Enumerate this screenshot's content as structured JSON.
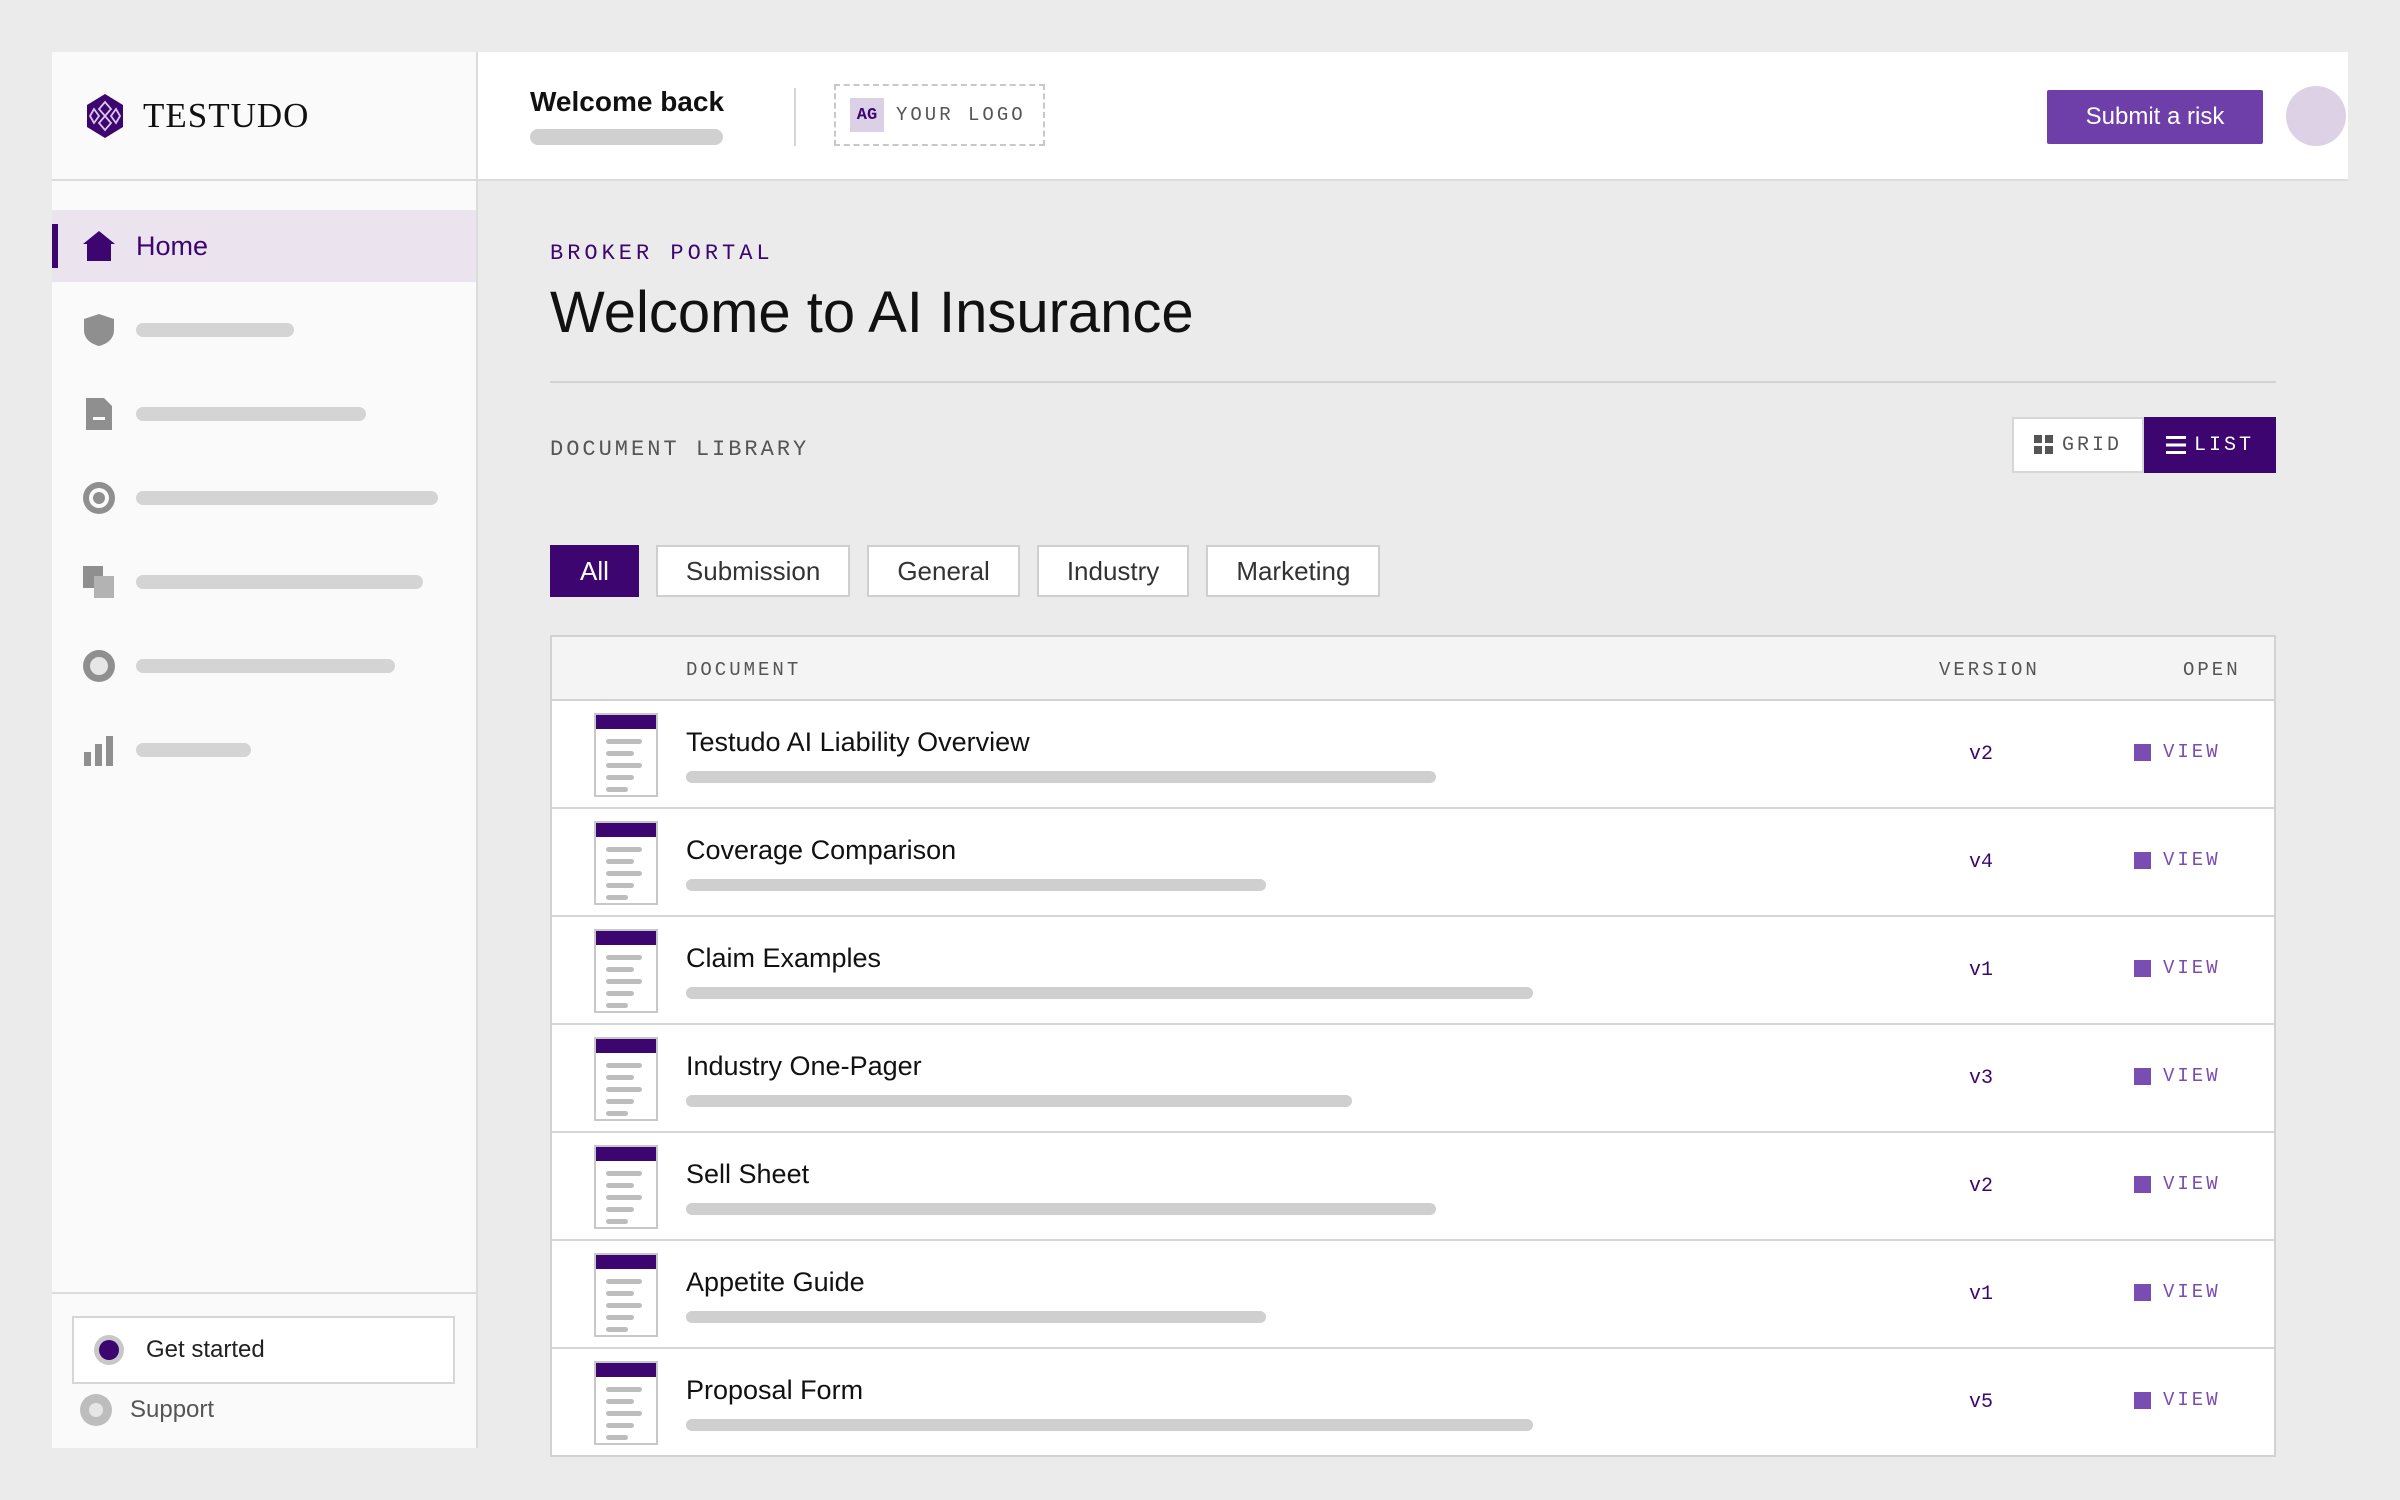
{
  "brand": {
    "name": "TESTUDO"
  },
  "nav": {
    "items": [
      {
        "label": "Home",
        "icon": "home-icon",
        "active": true
      },
      {
        "label": "",
        "icon": "shield-icon"
      },
      {
        "label": "",
        "icon": "document-icon"
      },
      {
        "label": "",
        "icon": "target-icon"
      },
      {
        "label": "",
        "icon": "copy-icon"
      },
      {
        "label": "",
        "icon": "circle-icon"
      },
      {
        "label": "",
        "icon": "bar-chart-icon"
      }
    ]
  },
  "sidebar_footer": {
    "get_started": "Get started",
    "support": "Support"
  },
  "header": {
    "welcome": "Welcome back",
    "logo_initials": "AG",
    "logo_placeholder": "YOUR LOGO",
    "submit_label": "Submit a risk"
  },
  "main": {
    "eyebrow": "BROKER PORTAL",
    "title": "Welcome to AI Insurance",
    "section_label": "DOCUMENT LIBRARY",
    "view_toggle": {
      "grid": "GRID",
      "list": "LIST",
      "selected": "LIST"
    },
    "filters": [
      "All",
      "Submission",
      "General",
      "Industry",
      "Marketing"
    ],
    "active_filter": "All",
    "table": {
      "headers": {
        "document": "DOCUMENT",
        "version": "VERSION",
        "open": "OPEN"
      },
      "rows": [
        {
          "title": "Testudo AI Liability Overview",
          "version": "v2",
          "action": "VIEW"
        },
        {
          "title": "Coverage Comparison",
          "version": "v4",
          "action": "VIEW"
        },
        {
          "title": "Claim Examples",
          "version": "v1",
          "action": "VIEW"
        },
        {
          "title": "Industry One-Pager",
          "version": "v3",
          "action": "VIEW"
        },
        {
          "title": "Sell Sheet",
          "version": "v2",
          "action": "VIEW"
        },
        {
          "title": "Appetite Guide",
          "version": "v1",
          "action": "VIEW"
        },
        {
          "title": "Proposal Form",
          "version": "v5",
          "action": "VIEW"
        }
      ]
    }
  },
  "colors": {
    "accent": "#3d0570",
    "button": "#6e3fa8",
    "link": "#7a4db3"
  }
}
